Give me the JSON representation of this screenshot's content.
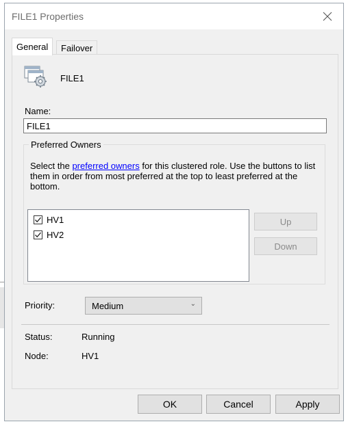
{
  "window": {
    "title": "FILE1 Properties"
  },
  "tabs": [
    {
      "label": "General"
    },
    {
      "label": "Failover"
    }
  ],
  "general": {
    "role_name": "FILE1",
    "name_label": "Name:",
    "name_value": "FILE1",
    "preferred_owners": {
      "legend": "Preferred Owners",
      "desc_pre": "Select the ",
      "desc_link": "preferred owners",
      "desc_post": " for this clustered role. Use the buttons to list them in order from most preferred at the top to least preferred at the bottom.",
      "owners": [
        {
          "name": "HV1",
          "checked": true
        },
        {
          "name": "HV2",
          "checked": true
        }
      ],
      "up_label": "Up",
      "down_label": "Down"
    },
    "priority_label": "Priority:",
    "priority_value": "Medium",
    "status_label": "Status:",
    "status_value": "Running",
    "node_label": "Node:",
    "node_value": "HV1"
  },
  "footer": {
    "ok_label": "OK",
    "cancel_label": "Cancel",
    "apply_label": "Apply"
  },
  "icons": {
    "close": "close-icon",
    "role": "clustered-role-icon",
    "checkbox": "checkmark-icon",
    "dropdown": "chevron-down-icon"
  }
}
